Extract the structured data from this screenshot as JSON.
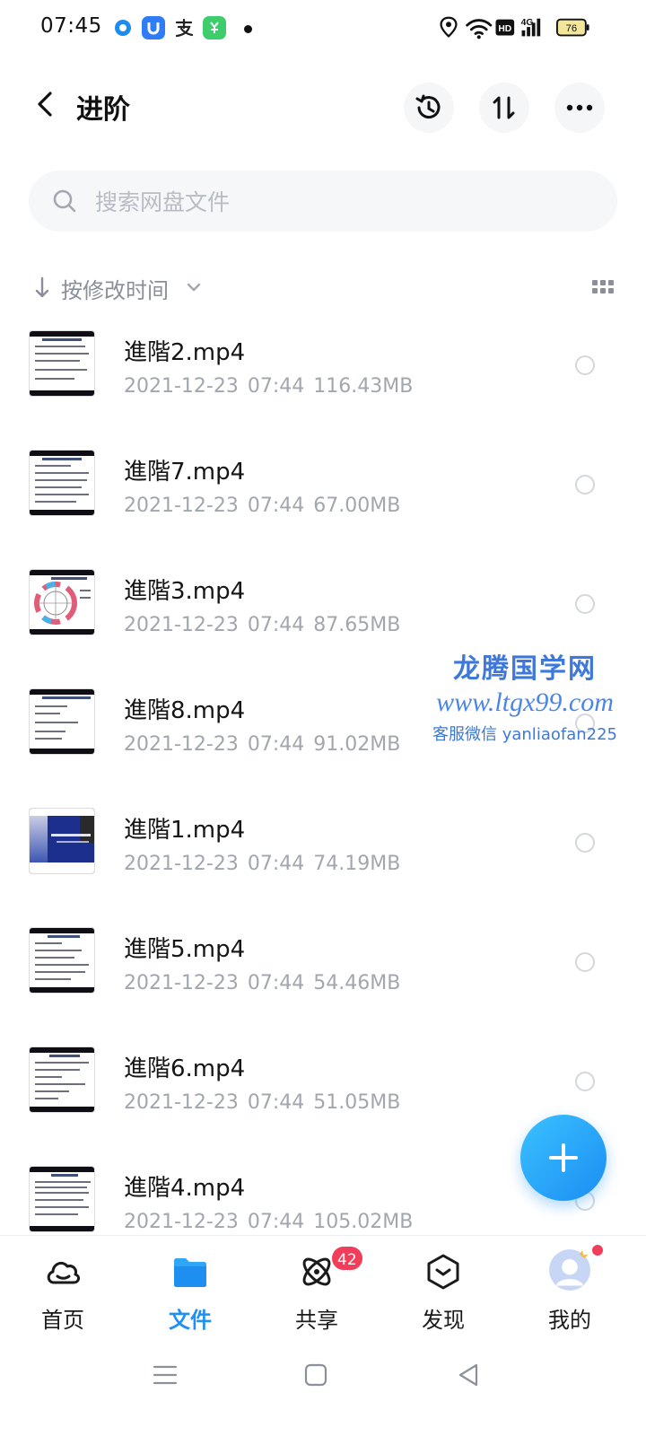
{
  "status_bar": {
    "time": "07:45",
    "app_icons": [
      "blue-dot-app-icon",
      "u-app-icon",
      "alipay-icon",
      "green-app-icon"
    ],
    "network": "4G",
    "hd": "HD",
    "battery": "76"
  },
  "header": {
    "title": "进阶"
  },
  "search": {
    "placeholder": "搜索网盘文件"
  },
  "sort": {
    "label": "按修改时间"
  },
  "files": [
    {
      "name": "進階2.mp4",
      "date": "2021-12-23",
      "time": "07:44",
      "size": "116.43MB"
    },
    {
      "name": "進階7.mp4",
      "date": "2021-12-23",
      "time": "07:44",
      "size": "67.00MB"
    },
    {
      "name": "進階3.mp4",
      "date": "2021-12-23",
      "time": "07:44",
      "size": "87.65MB"
    },
    {
      "name": "進階8.mp4",
      "date": "2021-12-23",
      "time": "07:44",
      "size": "91.02MB"
    },
    {
      "name": "進階1.mp4",
      "date": "2021-12-23",
      "time": "07:44",
      "size": "74.19MB"
    },
    {
      "name": "進階5.mp4",
      "date": "2021-12-23",
      "time": "07:44",
      "size": "54.46MB"
    },
    {
      "name": "進階6.mp4",
      "date": "2021-12-23",
      "time": "07:44",
      "size": "51.05MB"
    },
    {
      "name": "進階4.mp4",
      "date": "2021-12-23",
      "time": "07:44",
      "size": "105.02MB"
    }
  ],
  "watermark": {
    "title": "龙腾国学网",
    "url": "www.ltgx99.com",
    "contact": "客服微信 yanliaofan225"
  },
  "bottom_nav": {
    "home": "首页",
    "files": "文件",
    "share": "共享",
    "share_badge": "42",
    "discover": "发现",
    "me": "我的"
  },
  "colors": {
    "accent": "#1e90f5",
    "badge": "#f03e5a",
    "fab": "#1a8ef2"
  }
}
